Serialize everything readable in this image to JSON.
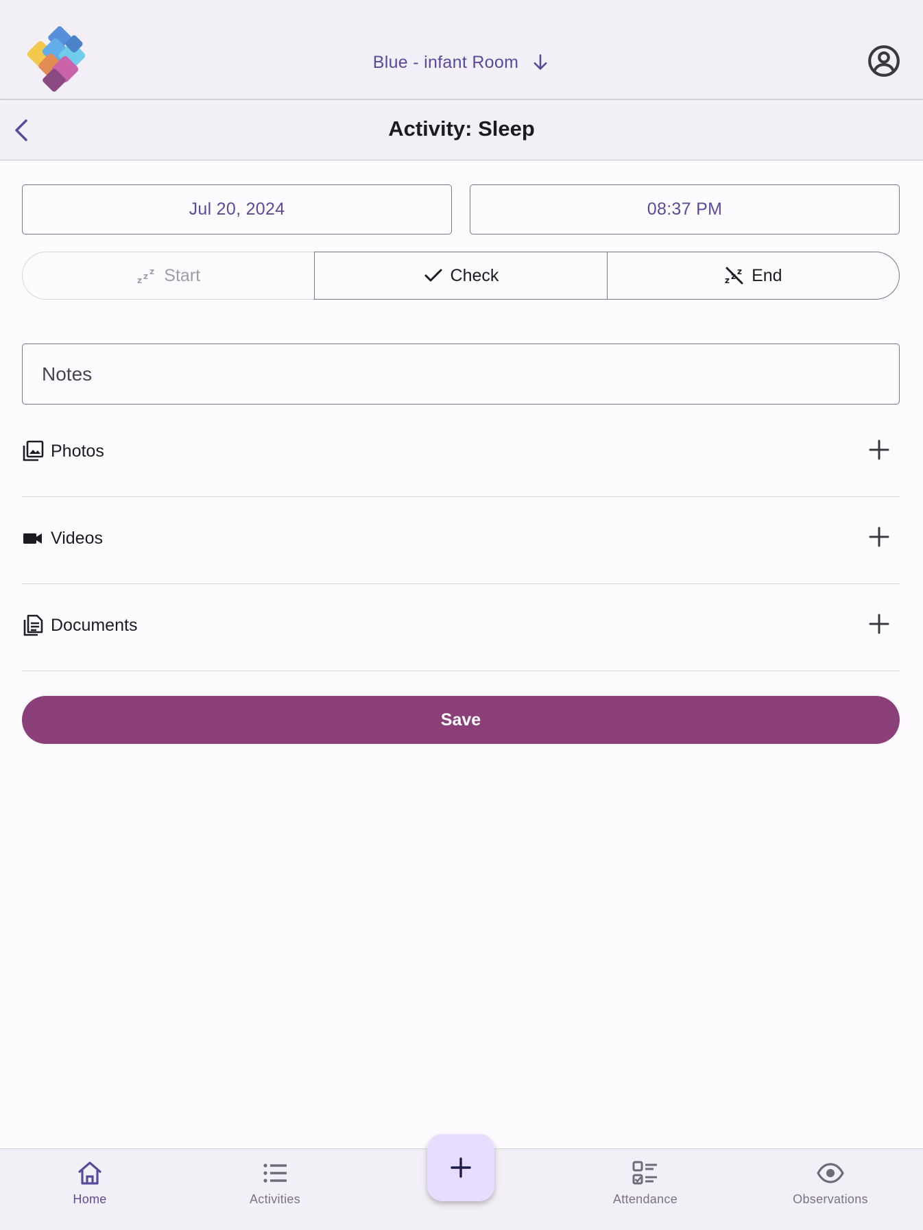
{
  "header": {
    "room_label": "Blue - infant Room",
    "room_dropdown_icon": "arrow-down-icon",
    "account_icon": "account-circle-icon",
    "logo_icon": "puzzle-logo"
  },
  "subheader": {
    "title": "Activity: Sleep",
    "back_icon": "chevron-left-icon"
  },
  "form": {
    "date": "Jul 20, 2024",
    "time": "08:37 PM",
    "segments": [
      {
        "label": "Start",
        "icon": "sleep-zzz-icon",
        "state": "disabled"
      },
      {
        "label": "Check",
        "icon": "check-icon",
        "state": "enabled"
      },
      {
        "label": "End",
        "icon": "sleep-off-icon",
        "state": "enabled"
      }
    ],
    "notes_placeholder": "Notes",
    "attachments": [
      {
        "label": "Photos",
        "icon": "photo-library-icon"
      },
      {
        "label": "Videos",
        "icon": "videocam-icon"
      },
      {
        "label": "Documents",
        "icon": "document-icon"
      }
    ],
    "save_label": "Save"
  },
  "bottom_nav": {
    "items": [
      {
        "label": "Home",
        "icon": "home-icon",
        "active": true
      },
      {
        "label": "Activities",
        "icon": "list-icon",
        "active": false
      },
      {
        "label": "Attendance",
        "icon": "checklist-icon",
        "active": false
      },
      {
        "label": "Observations",
        "icon": "eye-icon",
        "active": false
      }
    ],
    "fab_icon": "plus-icon"
  },
  "colors": {
    "accent": "#5a4a9c",
    "save_button": "#8b3f78",
    "fab_bg": "#e9ddff",
    "bar_bg": "#f3eff6"
  }
}
